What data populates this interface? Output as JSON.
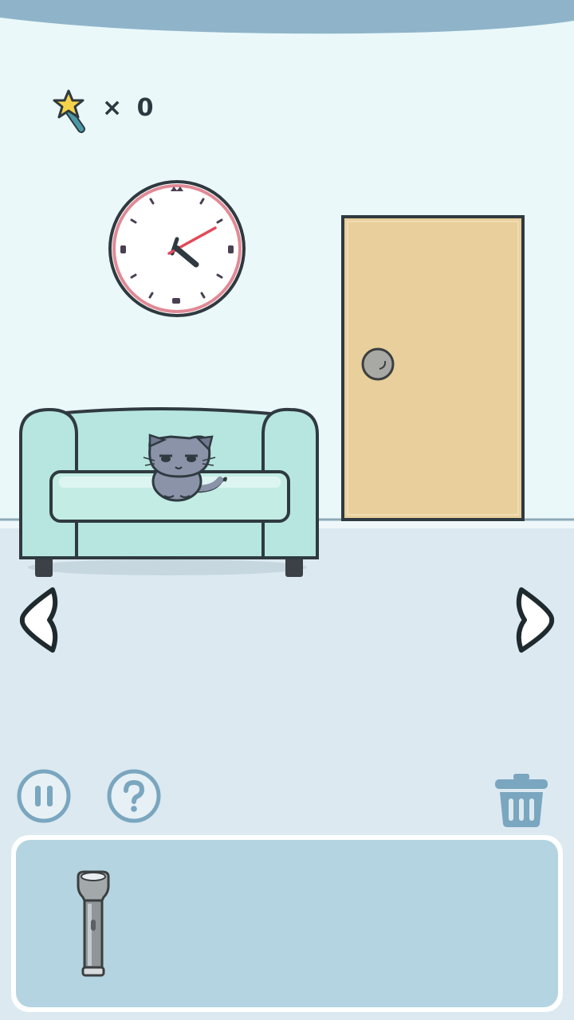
{
  "hud": {
    "hint_count": "× 0",
    "hint_icon": "magic-wand-star-icon"
  },
  "controls": {
    "left_arrow_icon": "chevron-left-icon",
    "right_arrow_icon": "chevron-right-icon",
    "pause_icon": "pause-icon",
    "help_icon": "question-icon",
    "trash_icon": "trash-icon"
  },
  "scene": {
    "objects": [
      "wall-clock",
      "door",
      "sofa",
      "cat"
    ]
  },
  "inventory": {
    "items": [
      {
        "name": "flashlight",
        "icon": "flashlight-icon"
      }
    ]
  },
  "colors": {
    "wall": "#eaf8fa",
    "floor": "#dce9f1",
    "top_bar": "#8fb4c9",
    "sofa": "#b6e6df",
    "door": "#e8cf9b",
    "inventory_bg": "#b4d4e1",
    "icon_blue": "#7aa6bf"
  }
}
